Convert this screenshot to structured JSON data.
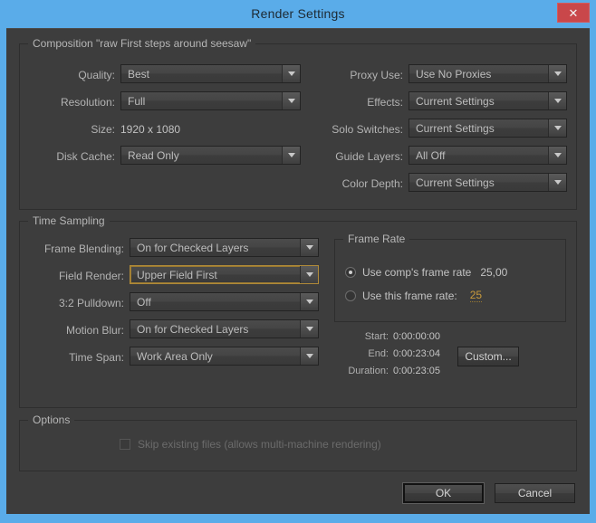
{
  "window": {
    "title": "Render Settings",
    "close_icon": "close-icon",
    "accent_color": "#5aace9",
    "close_button_color": "#c9474a",
    "dialog_bg": "#3d3d3d",
    "highlight_color": "#c89a3c"
  },
  "composition": {
    "group_title": "Composition \"raw First steps around seesaw\"",
    "left_rows": [
      {
        "label": "Quality:",
        "value": "Best",
        "type": "dropdown"
      },
      {
        "label": "Resolution:",
        "value": "Full",
        "type": "dropdown"
      },
      {
        "label": "Size:",
        "value": "1920 x 1080",
        "type": "static"
      },
      {
        "label": "Disk Cache:",
        "value": "Read Only",
        "type": "dropdown"
      }
    ],
    "right_rows": [
      {
        "label": "Proxy Use:",
        "value": "Use No Proxies",
        "type": "dropdown"
      },
      {
        "label": "Effects:",
        "value": "Current Settings",
        "type": "dropdown"
      },
      {
        "label": "Solo Switches:",
        "value": "Current Settings",
        "type": "dropdown"
      },
      {
        "label": "Guide Layers:",
        "value": "All Off",
        "type": "dropdown"
      },
      {
        "label": "Color Depth:",
        "value": "Current Settings",
        "type": "dropdown"
      }
    ]
  },
  "time_sampling": {
    "group_title": "Time Sampling",
    "rows": [
      {
        "label": "Frame Blending:",
        "value": "On for Checked Layers",
        "focused": false
      },
      {
        "label": "Field Render:",
        "value": "Upper Field First",
        "focused": true
      },
      {
        "label": "3:2 Pulldown:",
        "value": "Off",
        "focused": false
      },
      {
        "label": "Motion Blur:",
        "value": "On for Checked Layers",
        "focused": false
      },
      {
        "label": "Time Span:",
        "value": "Work Area Only",
        "focused": false
      }
    ]
  },
  "frame_rate": {
    "group_title": "Frame Rate",
    "option_comp_label": "Use comp's frame rate",
    "option_comp_value": "25,00",
    "option_comp_selected": true,
    "option_custom_label": "Use this frame rate:",
    "option_custom_value": "25",
    "option_custom_selected": false
  },
  "time_info": {
    "start_label": "Start:",
    "start_value": "0:00:00:00",
    "end_label": "End:",
    "end_value": "0:00:23:04",
    "duration_label": "Duration:",
    "duration_value": "0:00:23:05",
    "custom_button": "Custom..."
  },
  "options": {
    "group_title": "Options",
    "skip_existing_label": "Skip existing files (allows multi-machine rendering)",
    "skip_existing_checked": false,
    "skip_existing_enabled": false
  },
  "footer": {
    "ok_label": "OK",
    "cancel_label": "Cancel"
  }
}
